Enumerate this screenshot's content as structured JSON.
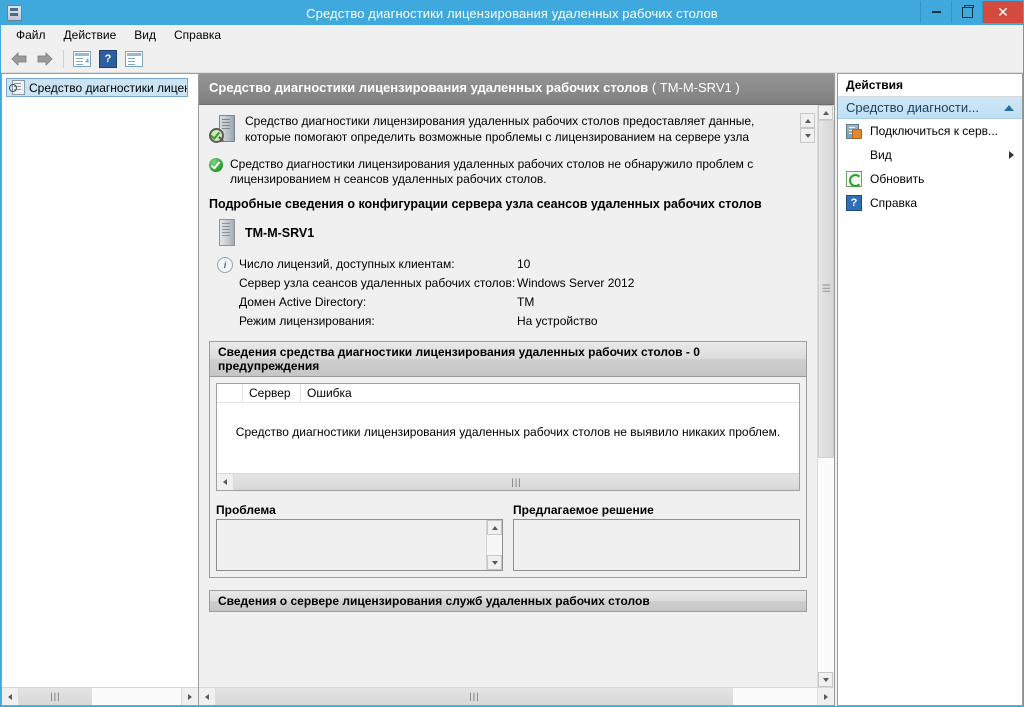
{
  "window": {
    "title": "Средство диагностики лицензирования удаленных рабочих столов",
    "icon": "mmc-console-icon",
    "buttons": {
      "minimize": "minimize-icon",
      "maximize": "restore-icon",
      "close": "✕"
    }
  },
  "menubar": {
    "items": [
      {
        "label": "Файл"
      },
      {
        "label": "Действие"
      },
      {
        "label": "Вид"
      },
      {
        "label": "Справка"
      }
    ]
  },
  "toolbar": {
    "back": "back-arrow-icon",
    "forward": "forward-arrow-icon",
    "show_hide_tree": "show-hide-console-tree-icon",
    "help": "?",
    "properties": "properties-icon"
  },
  "tree": {
    "node_label": "Средство диагностики лиценз",
    "node_icon": "licensing-diagnoser-node-icon"
  },
  "content": {
    "header_title": "Средство диагностики лицензирования удаленных рабочих столов",
    "header_server": "( TM-M-SRV1 )",
    "description": "Средство диагностики лицензирования удаленных рабочих столов предоставляет данные, которые помогают определить возможные проблемы с лицензированием на сервере узла сеансов удаленных",
    "status_message": "Средство диагностики лицензирования удаленных рабочих столов не обнаружило проблем с лицензированием н сеансов удаленных рабочих столов.",
    "config_section_title": "Подробные сведения о конфигурации сервера узла сеансов удаленных рабочих столов",
    "server_name": "TM-M-SRV1",
    "details": [
      {
        "key": "Число лицензий, доступных клиентам:",
        "value": "10"
      },
      {
        "key": "Сервер узла сеансов удаленных рабочих столов:",
        "value": "Windows Server 2012"
      },
      {
        "key": "Домен Active Directory:",
        "value": "TM"
      },
      {
        "key": "Режим лицензирования:",
        "value": "На устройство"
      }
    ],
    "diagnoser_group": {
      "title": "Сведения средства диагностики лицензирования удаленных рабочих столов - 0 предупреждения",
      "columns": [
        "",
        "Сервер",
        "Ошибка"
      ],
      "empty_message": "Средство диагностики лицензирования удаленных рабочих столов не выявило никаких проблем."
    },
    "problem_pane": {
      "label": "Проблема",
      "value": ""
    },
    "solution_pane": {
      "label": "Предлагаемое решение",
      "value": ""
    },
    "license_server_group": {
      "title": "Сведения о сервере лицензирования служб удаленных рабочих столов"
    }
  },
  "actions": {
    "title": "Действия",
    "group_label": "Средство диагности...",
    "items": [
      {
        "label": "Подключиться к серв...",
        "icon": "connect-to-server-icon",
        "submenu": false
      },
      {
        "label": "Вид",
        "icon": "",
        "submenu": true
      },
      {
        "label": "Обновить",
        "icon": "refresh-icon",
        "submenu": false
      },
      {
        "label": "Справка",
        "icon": "help-icon",
        "submenu": false
      }
    ]
  },
  "scrollbars": {
    "grip": "|||",
    "left_arrow": "‹",
    "right_arrow": "›"
  },
  "colors": {
    "titlebar": "#3fa8dc",
    "close_button": "#d44b3e",
    "content_header": "#8a8a8a",
    "actions_group": "#cde7f7",
    "status_ok": "#1f9e28"
  }
}
